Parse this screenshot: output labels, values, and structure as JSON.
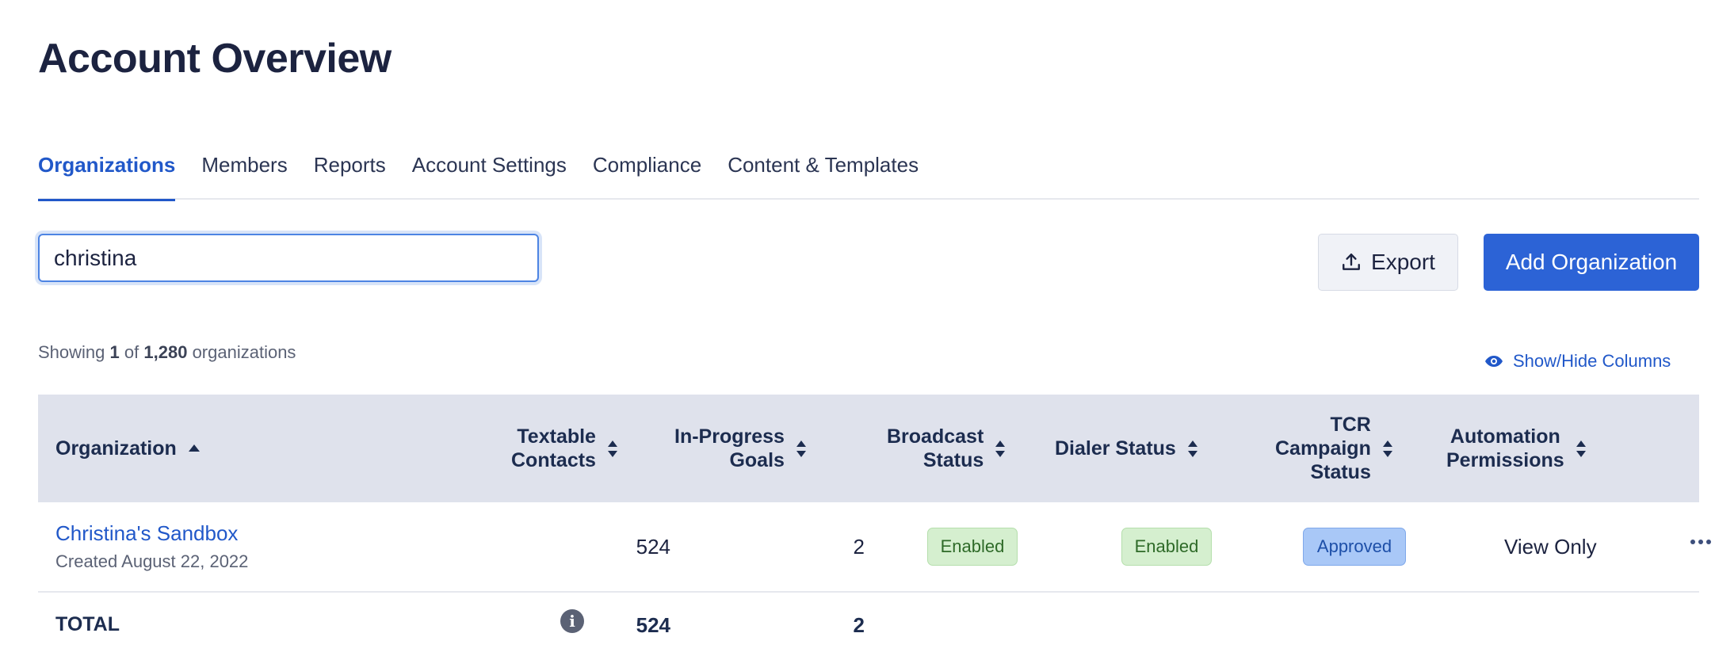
{
  "page": {
    "title": "Account Overview"
  },
  "tabs": [
    {
      "label": "Organizations",
      "active": true
    },
    {
      "label": "Members"
    },
    {
      "label": "Reports"
    },
    {
      "label": "Account Settings"
    },
    {
      "label": "Compliance"
    },
    {
      "label": "Content & Templates"
    }
  ],
  "search": {
    "value": "christina"
  },
  "toolbar": {
    "export_label": "Export",
    "add_label": "Add Organization",
    "export_icon": "upload-icon"
  },
  "summary": {
    "prefix": "Showing",
    "count": "1",
    "of": "of",
    "total": "1,280",
    "suffix": "organizations"
  },
  "show_hide": {
    "label": "Show/Hide Columns",
    "icon": "eye-icon"
  },
  "table": {
    "headers": {
      "organization": "Organization",
      "textable_1": "Textable",
      "textable_2": "Contacts",
      "goals_1": "In-Progress",
      "goals_2": "Goals",
      "broadcast_1": "Broadcast",
      "broadcast_2": "Status",
      "dialer": "Dialer Status",
      "tcr_1": "TCR",
      "tcr_2": "Campaign",
      "tcr_3": "Status",
      "auto_1": "Automation",
      "auto_2": "Permissions"
    },
    "rows": [
      {
        "name": "Christina's Sandbox",
        "created": "Created August 22, 2022",
        "textable": "524",
        "goals": "2",
        "broadcast": "Enabled",
        "dialer": "Enabled",
        "tcr": "Approved",
        "permissions": "View Only"
      }
    ],
    "total": {
      "label": "TOTAL",
      "textable": "524",
      "goals": "2",
      "info_icon": "info-icon"
    }
  },
  "colors": {
    "accent": "#2c63d6",
    "header_bg": "#dfe2ec",
    "badge_green": "#d5efcf",
    "badge_blue": "#a9c8f7"
  }
}
